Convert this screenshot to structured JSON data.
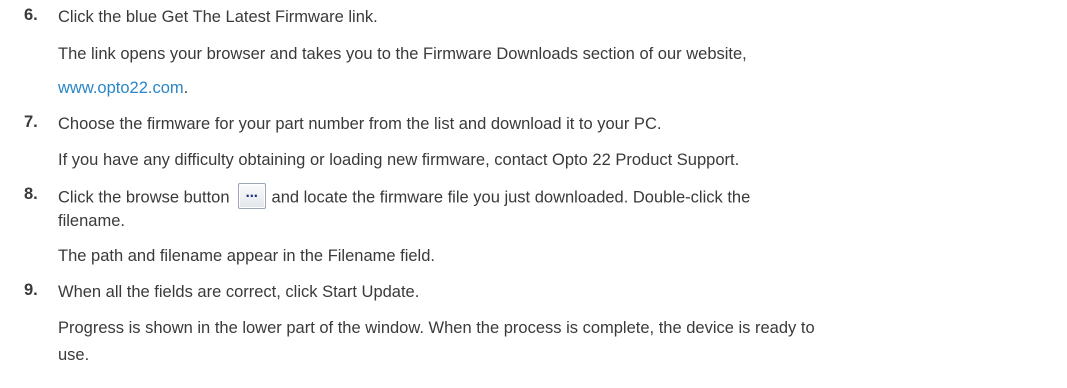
{
  "steps": [
    {
      "number": "6.",
      "instruction": "Click the blue Get The Latest Firmware link.",
      "detail_line1": "The link opens your browser and takes you to the Firmware Downloads section of our website,",
      "detail_link": "www.opto22.com",
      "detail_link_suffix": "."
    },
    {
      "number": "7.",
      "instruction": "Choose the firmware for your part number from the list and download it to your PC.",
      "detail": "If you have any difficulty obtaining or loading new firmware, contact Opto 22 Product Support."
    },
    {
      "number": "8.",
      "instruction_before_button": "Click the browse button",
      "browse_button_label": "...",
      "instruction_after_button": "and locate the firmware file you just downloaded. Double-click the",
      "instruction_line2": "filename.",
      "detail": "The path and filename appear in the Filename field."
    },
    {
      "number": "9.",
      "instruction": "When all the fields are correct, click Start Update.",
      "detail_line1": "Progress is shown in the lower part of the window. When the process is complete, the device is ready to",
      "detail_line2": "use."
    }
  ]
}
